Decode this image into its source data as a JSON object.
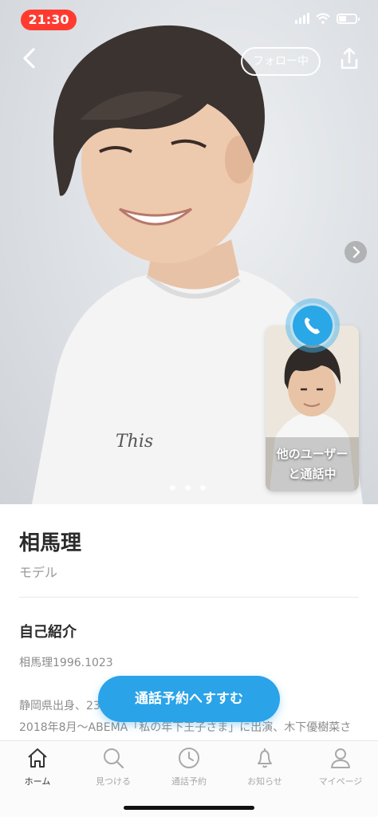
{
  "status_bar": {
    "time": "21:30"
  },
  "hero": {
    "follow_label": "フォロー中"
  },
  "call_preview": {
    "line1": "他のユーザー",
    "line2": "と通話中"
  },
  "profile": {
    "name": "相馬理",
    "role": "モデル",
    "section_title": "自己紹介",
    "bio": [
      "相馬理1996.1023",
      "静岡県出身、23",
      "2018年8月〜ABEMA「私の年下王子さま」に出演、木下優樹菜さ"
    ]
  },
  "cta": {
    "label": "通話予約へすすむ"
  },
  "tabs": [
    {
      "label": "ホーム",
      "icon": "home-icon",
      "active": true
    },
    {
      "label": "見つける",
      "icon": "search-icon",
      "active": false
    },
    {
      "label": "通話予約",
      "icon": "clock-icon",
      "active": false
    },
    {
      "label": "お知らせ",
      "icon": "bell-icon",
      "active": false
    },
    {
      "label": "マイページ",
      "icon": "user-icon",
      "active": false
    }
  ],
  "colors": {
    "accent": "#2aa3e8",
    "time_pill": "#ff3b30"
  }
}
